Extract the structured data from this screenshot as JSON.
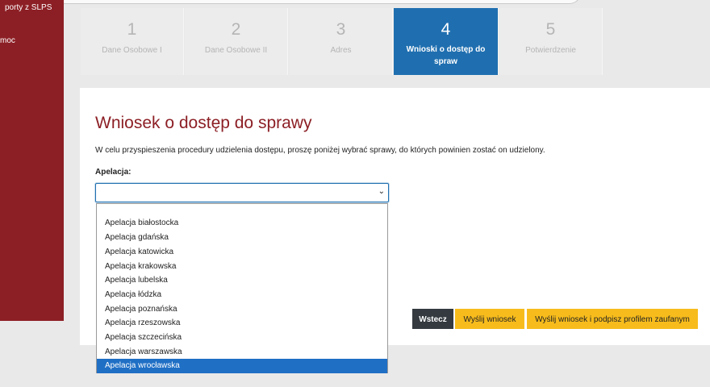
{
  "sidebar": {
    "items": [
      {
        "label": "porty z SLPS"
      },
      {
        "label": "moc"
      }
    ]
  },
  "stepper": {
    "steps": [
      {
        "number": "1",
        "label": "Dane Osobowe I"
      },
      {
        "number": "2",
        "label": "Dane Osobowe II"
      },
      {
        "number": "3",
        "label": "Adres"
      },
      {
        "number": "4",
        "label": "Wnioski o dostęp do spraw",
        "active": true
      },
      {
        "number": "5",
        "label": "Potwierdzenie"
      }
    ]
  },
  "main": {
    "title": "Wniosek o dostęp do sprawy",
    "intro": "W celu przyspieszenia procedury udzielenia dostępu, proszę poniżej wybrać sprawy, do których powinien zostać on udzielony.",
    "apelacja_label": "Apelacja:",
    "select": {
      "value": "",
      "options": [
        "",
        "Apelacja białostocka",
        "Apelacja gdańska",
        "Apelacja katowicka",
        "Apelacja krakowska",
        "Apelacja lubelska",
        "Apelacja łódzka",
        "Apelacja poznańska",
        "Apelacja rzeszowska",
        "Apelacja szczecińska",
        "Apelacja warszawska",
        "Apelacja wrocławska"
      ],
      "highlighted": "Apelacja wrocławska"
    }
  },
  "buttons": {
    "back": "Wstecz",
    "send": "Wyślij wniosek",
    "send_sign": "Wyślij wniosek i podpisz profilem zaufanym"
  },
  "colors": {
    "brand": "#8c1f25",
    "active_step": "#1f6fb0",
    "primary_button": "#f7bc1c",
    "dark_button": "#343a40"
  }
}
